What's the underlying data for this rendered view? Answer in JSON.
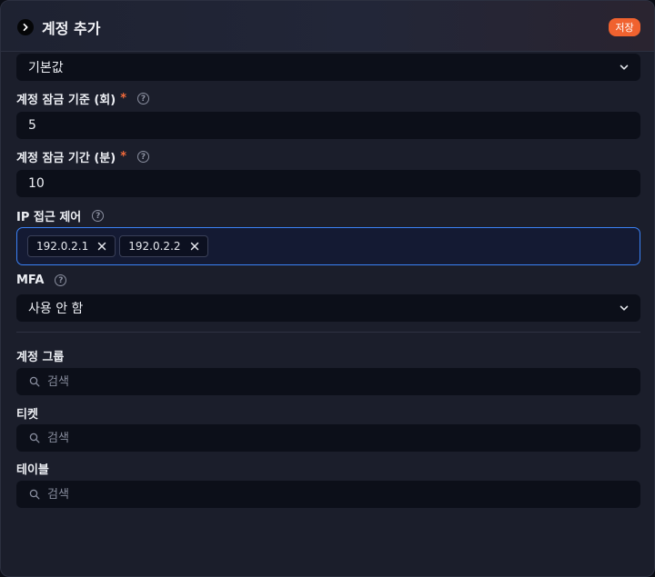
{
  "header": {
    "title": "계정 추가",
    "save_label": "저장"
  },
  "fields": {
    "preset": {
      "value": "기본값"
    },
    "lock_threshold": {
      "label": "계정 잠금 기준 (회)",
      "required": "*",
      "value": "5"
    },
    "lock_duration": {
      "label": "계정 잠금 기간 (분)",
      "required": "*",
      "value": "10"
    },
    "ip_access": {
      "label": "IP 접근 제어",
      "tags": [
        "192.0.2.1",
        "192.0.2.2"
      ]
    },
    "mfa": {
      "label": "MFA",
      "value": "사용 안 함"
    }
  },
  "groups": {
    "account_group": {
      "label": "계정 그룹",
      "placeholder": "검색"
    },
    "ticket": {
      "label": "티켓",
      "placeholder": "검색"
    },
    "table": {
      "label": "테이블",
      "placeholder": "검색"
    }
  },
  "icons": {
    "expand": "chevron-right-icon",
    "dropdown": "chevron-down-icon",
    "help": "question-circle-icon",
    "remove": "close-icon",
    "search": "search-icon"
  },
  "colors": {
    "accent": "#f0622f",
    "focus": "#3b82f6",
    "background": "#1b1e2b",
    "input": "#0c0f19"
  }
}
